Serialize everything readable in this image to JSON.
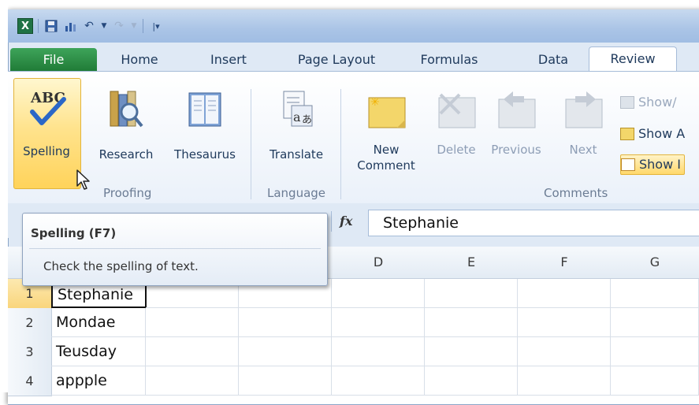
{
  "quick_access": {
    "app_icon": "X",
    "items": [
      "excel-icon",
      "save-icon",
      "chart-icon",
      "undo-icon",
      "undo-dropdown-icon",
      "redo-icon",
      "redo-dropdown-icon",
      "customize-icon"
    ]
  },
  "tabs": [
    {
      "label": "File"
    },
    {
      "label": "Home"
    },
    {
      "label": "Insert"
    },
    {
      "label": "Page Layout"
    },
    {
      "label": "Formulas"
    },
    {
      "label": "Data"
    },
    {
      "label": "Review"
    }
  ],
  "ribbon": {
    "proofing": {
      "spelling": "Spelling",
      "research": "Research",
      "thesaurus": "Thesaurus",
      "group_label": "Proofing"
    },
    "language": {
      "translate": "Translate",
      "group_label": "Language"
    },
    "comments": {
      "new_line1": "New",
      "new_line2": "Comment",
      "delete": "Delete",
      "previous": "Previous",
      "next": "Next",
      "show_hide": "Show/",
      "show_all": "Show A",
      "show_ink": "Show I",
      "group_label": "Comments"
    }
  },
  "formula_bar": {
    "fx": "fx",
    "value": "Stephanie"
  },
  "tooltip": {
    "title": "Spelling (F7)",
    "body": "Check the spelling of text."
  },
  "columns": [
    "D",
    "E",
    "F",
    "G"
  ],
  "rows": [
    {
      "num": "1",
      "a": "Stephanie"
    },
    {
      "num": "2",
      "a": "Mondae"
    },
    {
      "num": "3",
      "a": "Teusday"
    },
    {
      "num": "4",
      "a": "appple"
    }
  ],
  "colors": {
    "file_tab": "#1f7a36",
    "highlight": "#ffd35a",
    "ribbon_text": "#1e395b"
  }
}
